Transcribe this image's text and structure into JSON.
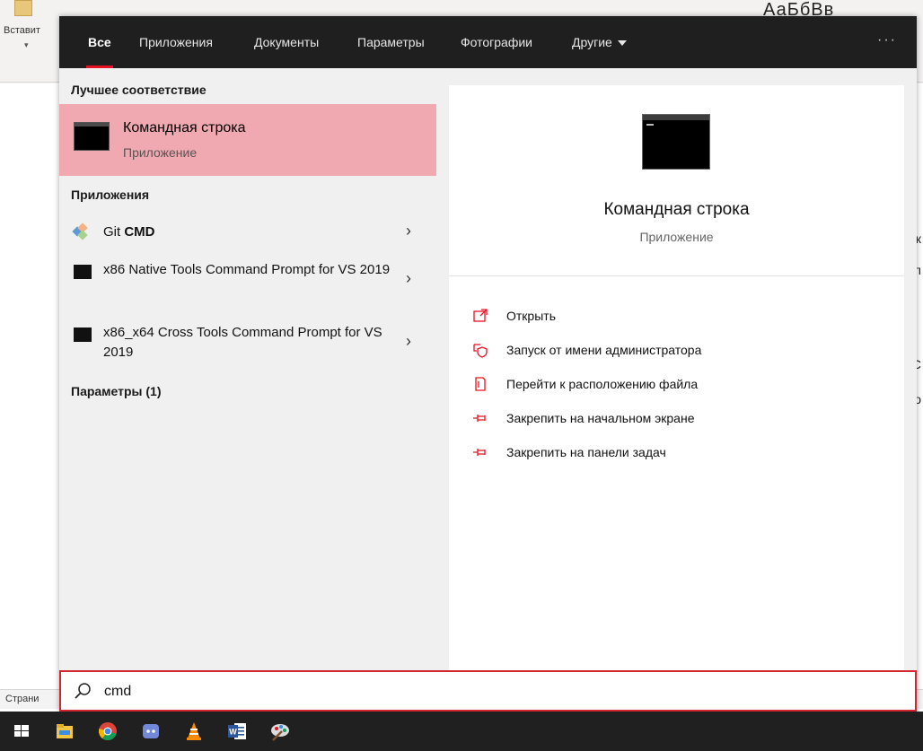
{
  "background_app": {
    "paste_label": "Вставит",
    "styles_text": "АаБбВв",
    "status_text": "Страни"
  },
  "search_panel": {
    "tabs": [
      {
        "label": "Все",
        "active": true
      },
      {
        "label": "Приложения",
        "active": false
      },
      {
        "label": "Документы",
        "active": false
      },
      {
        "label": "Параметры",
        "active": false
      },
      {
        "label": "Фотографии",
        "active": false
      },
      {
        "label": "Другие",
        "active": false
      }
    ],
    "more_label": "···",
    "best_match_header": "Лучшее соответствие",
    "best_match": {
      "title": "Командная строка",
      "subtitle": "Приложение",
      "icon": "cmd-icon"
    },
    "apps_header": "Приложения",
    "apps": [
      {
        "label_plain": "Git ",
        "label_bold": "CMD",
        "icon": "git-icon"
      },
      {
        "label": "x86 Native Tools Command Prompt for VS 2019",
        "icon": "cmd-icon"
      },
      {
        "label": "x86_x64 Cross Tools Command Prompt for VS 2019",
        "icon": "cmd-icon"
      }
    ],
    "settings_header": "Параметры (1)",
    "preview": {
      "title": "Командная строка",
      "subtitle": "Приложение",
      "actions": [
        {
          "label": "Открыть",
          "icon": "open-icon"
        },
        {
          "label": "Запуск от имени администратора",
          "icon": "shield-icon"
        },
        {
          "label": "Перейти к расположению файла",
          "icon": "file-location-icon"
        },
        {
          "label": "Закрепить на начальном экране",
          "icon": "pin-icon"
        },
        {
          "label": "Закрепить на панели задач",
          "icon": "pin-icon"
        }
      ]
    },
    "search": {
      "value": "cmd",
      "icon": "search-icon"
    }
  },
  "taskbar": {
    "items": [
      "start-icon",
      "file-explorer-icon",
      "chrome-icon",
      "discord-icon",
      "vlc-icon",
      "word-icon",
      "paint-icon"
    ]
  },
  "colors": {
    "accent": "#e81123",
    "best_match_bg": "#f0a9b0",
    "tabs_bg": "#1f1f1f",
    "taskbar_bg": "#202020",
    "search_border": "#d1262f"
  }
}
